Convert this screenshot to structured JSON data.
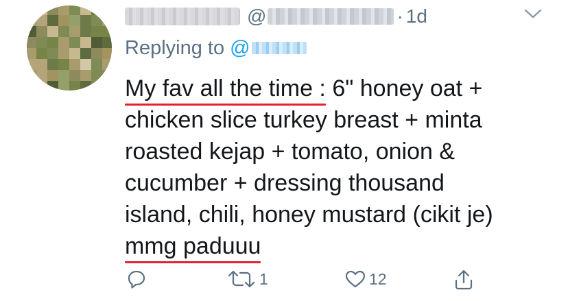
{
  "tweet": {
    "display_name_redacted": true,
    "handle_prefix": "@",
    "separator": "·",
    "timestamp": "1d",
    "replying_label": "Replying to",
    "replying_prefix": "@",
    "body_lines": [
      {
        "underlined": "My fav all the time :",
        "rest": " 6\" honey oat +"
      },
      {
        "text": "chicken slice turkey breast + minta"
      },
      {
        "text": "roasted kejap + tomato, onion &"
      },
      {
        "text": "cucumber + dressing thousand"
      },
      {
        "text": "island, chili, honey mustard (cikit je)"
      },
      {
        "underlined": "mmg paduuu",
        "rest": ""
      }
    ]
  },
  "actions": {
    "reply": {
      "icon": "reply-icon",
      "count": ""
    },
    "retweet": {
      "icon": "retweet-icon",
      "count": "1"
    },
    "like": {
      "icon": "heart-icon",
      "count": "12"
    },
    "share": {
      "icon": "share-icon",
      "count": ""
    }
  },
  "colors": {
    "secondary_text": "#5b7083",
    "link": "#1da1f2",
    "body_text": "#14171a",
    "underline": "#e0232e"
  },
  "icons": {
    "more": "chevron-down-icon"
  }
}
